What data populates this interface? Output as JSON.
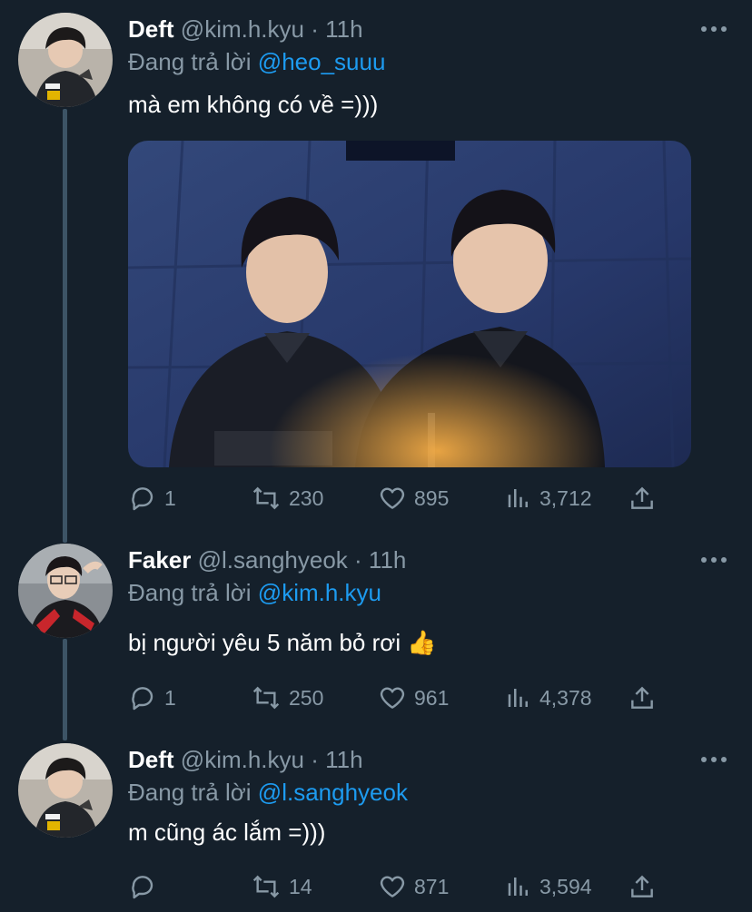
{
  "tweets": [
    {
      "name": "Deft",
      "handle": "@kim.h.kyu",
      "dot": "·",
      "time": "11h",
      "replying_label": "Đang trả lời",
      "replying_to": "@heo_suuu",
      "text": "mà em không có về =)))",
      "has_media": true,
      "stats": {
        "replies": "1",
        "retweets": "230",
        "likes": "895",
        "views": "3,712"
      },
      "icons": [
        "reply-icon",
        "retweet-icon",
        "like-icon",
        "views-icon",
        "share-icon"
      ]
    },
    {
      "name": "Faker",
      "handle": "@l.sanghyeok",
      "dot": "·",
      "time": "11h",
      "replying_label": "Đang trả lời",
      "replying_to": "@kim.h.kyu",
      "text": "bị người yêu 5 năm bỏ rơi 👍",
      "has_media": false,
      "stats": {
        "replies": "1",
        "retweets": "250",
        "likes": "961",
        "views": "4,378"
      },
      "icons": [
        "reply-icon",
        "retweet-icon",
        "like-icon",
        "views-icon",
        "share-icon"
      ]
    },
    {
      "name": "Deft",
      "handle": "@kim.h.kyu",
      "dot": "·",
      "time": "11h",
      "replying_label": "Đang trả lời",
      "replying_to": "@l.sanghyeok",
      "text": "m cũng ác lắm =)))",
      "has_media": false,
      "stats": {
        "replies": "",
        "retweets": "14",
        "likes": "871",
        "views": "3,594"
      },
      "icons": [
        "reply-icon",
        "retweet-icon",
        "like-icon",
        "views-icon",
        "share-icon"
      ]
    }
  ],
  "colors": {
    "background": "#15202b",
    "primary_text": "#ffffff",
    "secondary_text": "#8899a6",
    "mention": "#1d9bf0",
    "thread_line": "#3d5466"
  }
}
